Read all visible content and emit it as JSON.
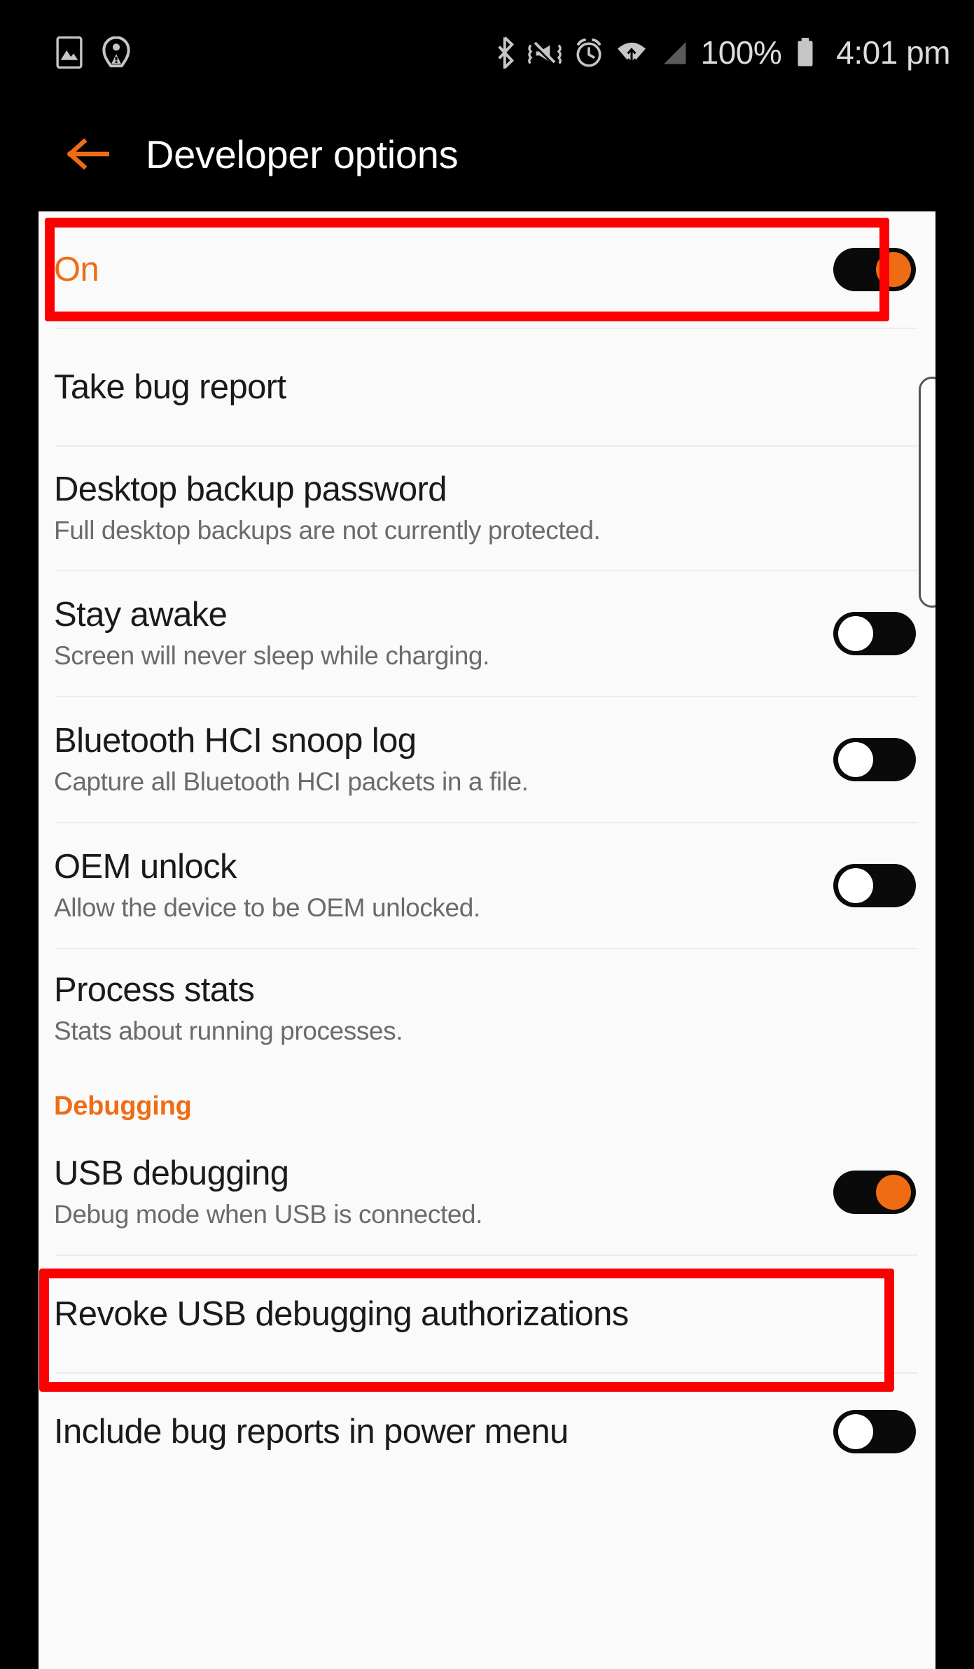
{
  "status_bar": {
    "icons_left": [
      "photo-icon",
      "nfc-tag-icon"
    ],
    "icons_right": [
      "bluetooth-icon",
      "mute-vibrate-icon",
      "alarm-icon",
      "wifi-icon",
      "signal-icon"
    ],
    "battery_percent": "100%",
    "battery_icon": "battery-full-icon",
    "time": "4:01 pm"
  },
  "action_bar": {
    "back_icon": "back-arrow-icon",
    "title": "Developer options",
    "accent_color": "#ef6c14"
  },
  "colors": {
    "accent": "#ef6c14",
    "highlight": "#fb0000",
    "panel_bg": "#fafafa",
    "title_text": "#1a1a1a",
    "summary_text": "#6b6b6b"
  },
  "list": {
    "rows": [
      {
        "id": "developer-options-master",
        "title": "On",
        "summary": "",
        "title_accent": true,
        "switch": "on",
        "highlighted": true
      },
      {
        "id": "take-bug-report",
        "title": "Take bug report",
        "summary": "",
        "title_accent": false,
        "switch": "none",
        "highlighted": false
      },
      {
        "id": "desktop-backup-password",
        "title": "Desktop backup password",
        "summary": "Full desktop backups are not currently protected.",
        "title_accent": false,
        "switch": "none",
        "highlighted": false
      },
      {
        "id": "stay-awake",
        "title": "Stay awake",
        "summary": "Screen will never sleep while charging.",
        "title_accent": false,
        "switch": "off",
        "highlighted": false
      },
      {
        "id": "bluetooth-hci-snoop-log",
        "title": "Bluetooth HCI snoop log",
        "summary": "Capture all Bluetooth HCI packets in a file.",
        "title_accent": false,
        "switch": "off",
        "highlighted": false
      },
      {
        "id": "oem-unlock",
        "title": "OEM unlock",
        "summary": "Allow the device to be OEM unlocked.",
        "title_accent": false,
        "switch": "off",
        "highlighted": false
      },
      {
        "id": "process-stats",
        "title": "Process stats",
        "summary": "Stats about running processes.",
        "title_accent": false,
        "switch": "none",
        "highlighted": false
      }
    ],
    "section_debugging": {
      "label": "Debugging"
    },
    "rows_debugging": [
      {
        "id": "usb-debugging",
        "title": "USB debugging",
        "summary": "Debug mode when USB is connected.",
        "title_accent": false,
        "switch": "on",
        "highlighted": true
      },
      {
        "id": "revoke-usb-debugging-authorizations",
        "title": "Revoke USB debugging authorizations",
        "summary": "",
        "title_accent": false,
        "switch": "none",
        "highlighted": false
      },
      {
        "id": "include-bug-reports-in-power-menu",
        "title": "Include bug reports in power menu",
        "summary": "",
        "title_accent": false,
        "switch": "off",
        "highlighted": false
      }
    ]
  }
}
